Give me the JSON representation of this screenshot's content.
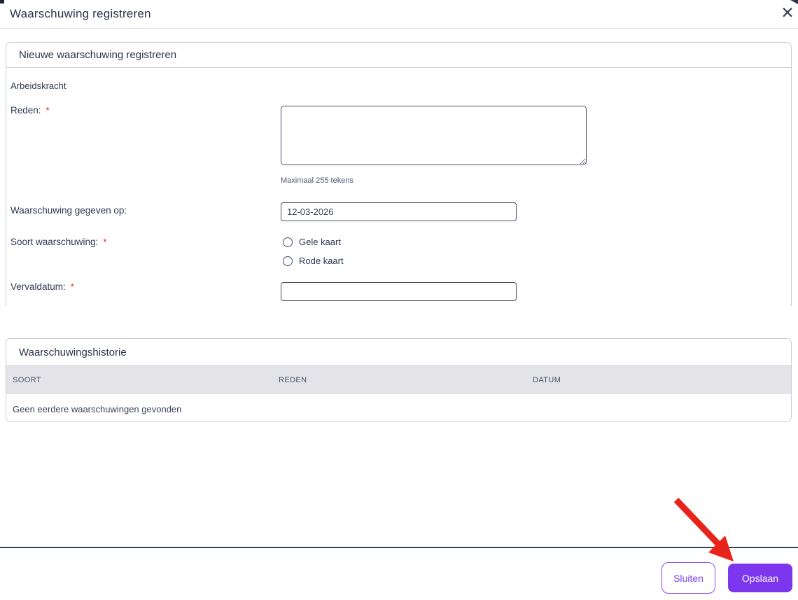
{
  "dialog": {
    "title": "Waarschuwing registreren",
    "close_icon": "✕"
  },
  "form_section": {
    "title": "Nieuwe waarschuwing registreren",
    "worker_label": "Arbeidskracht",
    "required_marker": "*",
    "fields": {
      "reden": {
        "label": "Reden:",
        "required": true,
        "value": "",
        "hint": "Maximaal 255 tekens"
      },
      "gegeven_op": {
        "label": "Waarschuwing gegeven op:",
        "required": false,
        "value": "12-03-2026"
      },
      "soort": {
        "label": "Soort waarschuwing:",
        "required": true,
        "options": [
          {
            "label": "Gele kaart",
            "checked": false
          },
          {
            "label": "Rode kaart",
            "checked": false
          }
        ]
      },
      "vervaldatum": {
        "label": "Vervaldatum:",
        "required": true,
        "value": ""
      }
    }
  },
  "history_section": {
    "title": "Waarschuwingshistorie",
    "columns": [
      "SOORT",
      "REDEN",
      "DATUM"
    ],
    "empty_message": "Geen eerdere waarschuwingen gevonden"
  },
  "footer": {
    "close_label": "Sluiten",
    "save_label": "Opslaan"
  },
  "colors": {
    "accent": "#7c36ee",
    "required": "#e0251c",
    "annotation_arrow": "#e8231a",
    "table_header_bg": "#e4e4e8",
    "border": "#c9cdd5",
    "input_border": "#434f6b"
  }
}
